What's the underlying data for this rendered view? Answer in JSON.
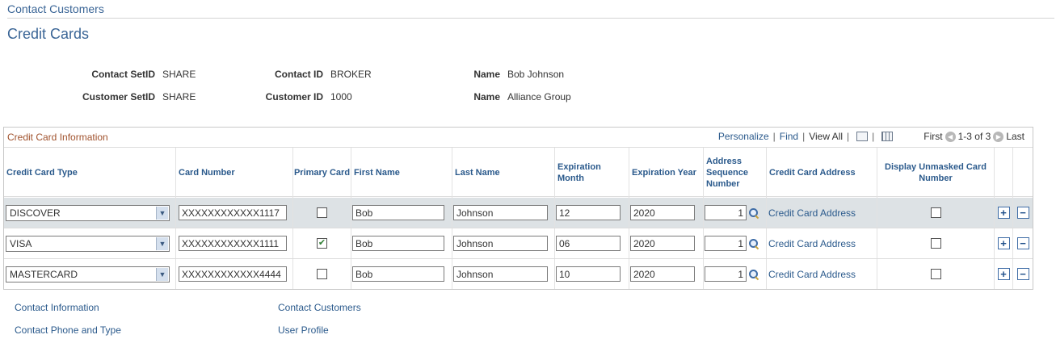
{
  "breadcrumb": "Contact Customers",
  "page_title": "Credit Cards",
  "header_fields": {
    "contact_setid_label": "Contact SetID",
    "contact_setid_value": "SHARE",
    "contact_id_label": "Contact ID",
    "contact_id_value": "BROKER",
    "name1_label": "Name",
    "name1_value": "Bob Johnson",
    "customer_setid_label": "Customer SetID",
    "customer_setid_value": "SHARE",
    "customer_id_label": "Customer ID",
    "customer_id_value": "1000",
    "name2_label": "Name",
    "name2_value": "Alliance Group"
  },
  "grid": {
    "title": "Credit Card Information",
    "personalize": "Personalize",
    "find": "Find",
    "view_all": "View All",
    "first": "First",
    "range": "1-3 of 3",
    "last": "Last",
    "columns": {
      "card_type": "Credit Card Type",
      "card_number": "Card Number",
      "primary_card": "Primary Card",
      "first_name": "First Name",
      "last_name": "Last Name",
      "exp_month": "Expiration Month",
      "exp_year": "Expiration Year",
      "addr_seq": "Address Sequence Number",
      "cc_address": "Credit Card Address",
      "unmasked": "Display Unmasked Card Number"
    },
    "rows": [
      {
        "card_type": "DISCOVER",
        "card_number": "XXXXXXXXXXXX1117",
        "primary": false,
        "first_name": "Bob",
        "last_name": "Johnson",
        "exp_month": "12",
        "exp_year": "2020",
        "addr_seq": "1",
        "cc_address": "Credit Card Address",
        "unmasked": false
      },
      {
        "card_type": "VISA",
        "card_number": "XXXXXXXXXXXX1111",
        "primary": true,
        "first_name": "Bob",
        "last_name": "Johnson",
        "exp_month": "06",
        "exp_year": "2020",
        "addr_seq": "1",
        "cc_address": "Credit Card Address",
        "unmasked": false
      },
      {
        "card_type": "MASTERCARD",
        "card_number": "XXXXXXXXXXXX4444",
        "primary": false,
        "first_name": "Bob",
        "last_name": "Johnson",
        "exp_month": "10",
        "exp_year": "2020",
        "addr_seq": "1",
        "cc_address": "Credit Card Address",
        "unmasked": false
      }
    ]
  },
  "footer_links": {
    "contact_information": "Contact Information",
    "contact_customers": "Contact Customers",
    "contact_phone_type": "Contact Phone and Type",
    "user_profile": "User Profile"
  },
  "colors": {
    "link": "#2b5a8c",
    "grid_title": "#a0522d",
    "alt_row": "#dde2e5"
  }
}
